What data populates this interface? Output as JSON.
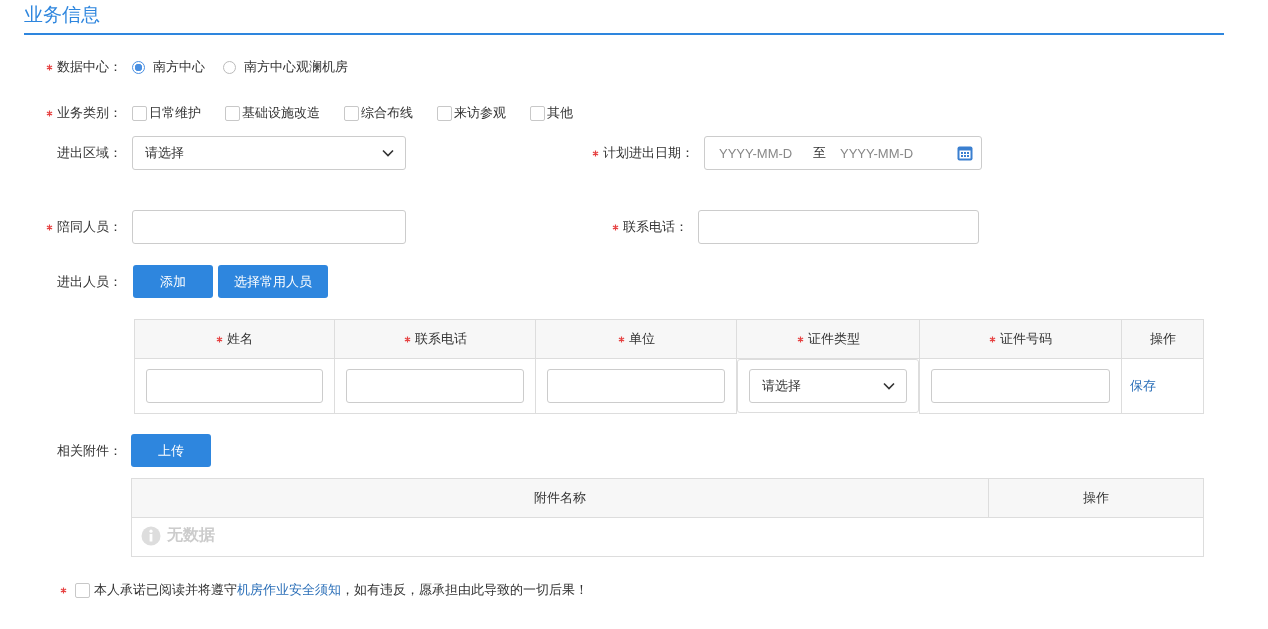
{
  "section_title": "业务信息",
  "data_center": {
    "label": "数据中心：",
    "required": true,
    "options": [
      {
        "label": "南方中心",
        "selected": true
      },
      {
        "label": "南方中心观澜机房",
        "selected": false
      }
    ]
  },
  "business_type": {
    "label": "业务类别：",
    "required": true,
    "options": [
      {
        "label": "日常维护",
        "checked": false
      },
      {
        "label": "基础设施改造",
        "checked": false
      },
      {
        "label": "综合布线",
        "checked": false
      },
      {
        "label": "来访参观",
        "checked": false
      },
      {
        "label": "其他",
        "checked": false
      }
    ]
  },
  "area": {
    "label": "进出区域：",
    "value": "请选择"
  },
  "planned_date": {
    "label": "计划进出日期：",
    "required": true,
    "start_placeholder": "YYYY-MM-D",
    "separator": "至",
    "end_placeholder": "YYYY-MM-D"
  },
  "escort": {
    "label": "陪同人员：",
    "required": true
  },
  "contact_phone": {
    "label": "联系电话：",
    "required": true
  },
  "persons": {
    "label": "进出人员：",
    "buttons": [
      "添加",
      "选择常用人员"
    ],
    "columns": [
      {
        "label": "姓名",
        "required": true
      },
      {
        "label": "联系电话",
        "required": true
      },
      {
        "label": "单位",
        "required": true
      },
      {
        "label": "证件类型",
        "required": true
      },
      {
        "label": "证件号码",
        "required": true
      },
      {
        "label": "操作",
        "required": false
      }
    ],
    "row": [
      {
        "kind": "input"
      },
      {
        "kind": "input"
      },
      {
        "kind": "input"
      },
      {
        "kind": "select",
        "value": "请选择"
      },
      {
        "kind": "input"
      },
      {
        "kind": "link",
        "text": "保存"
      }
    ]
  },
  "attachments": {
    "label": "相关附件：",
    "button": "上传",
    "columns": [
      "附件名称",
      "操作"
    ],
    "empty_text": "无数据"
  },
  "agreement": {
    "required": true,
    "checked": false,
    "text_before": "本人承诺已阅读并将遵守",
    "link": "机房作业安全须知",
    "text_after": "，如有违反，愿承担由此导致的一切后果！"
  }
}
